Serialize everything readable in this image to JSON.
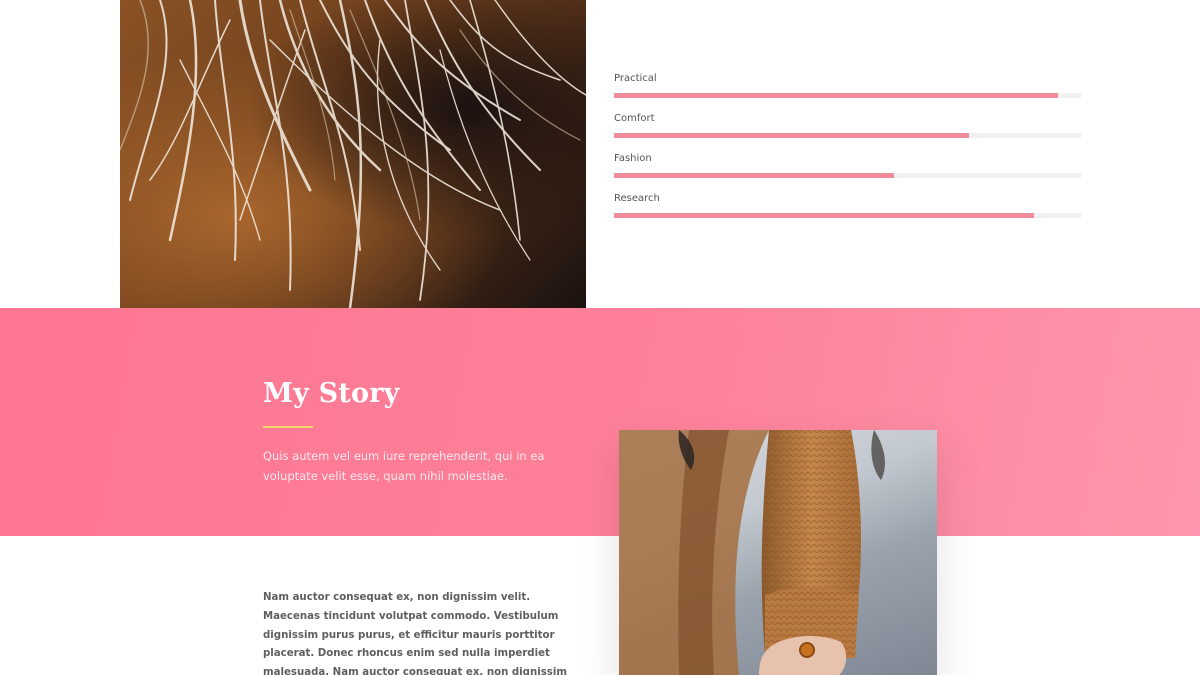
{
  "skills": [
    {
      "label": "Practical",
      "percent": 95
    },
    {
      "label": "Comfort",
      "percent": 76
    },
    {
      "label": "Fashion",
      "percent": 60
    },
    {
      "label": "Research",
      "percent": 90
    }
  ],
  "story": {
    "title": "My Story",
    "intro": "Quis autem vel eum iure reprehenderit, qui in ea voluptate velit esse, quam nihil molestiae.",
    "body": "Nam auctor consequat ex, non dignissim velit. Maecenas tincidunt volutpat commodo. Vestibulum dignissim purus purus, et efficitur mauris porttitor placerat. Donec rhoncus enim sed nulla imperdiet malesuada. Nam auctor consequat ex, non dignissim velit. Maecenas tincidunt volutpat"
  },
  "colors": {
    "accent": "#f08b9c",
    "band_start": "#fd7591",
    "band_end": "#fe96ad",
    "divider": "#f6d36b"
  }
}
